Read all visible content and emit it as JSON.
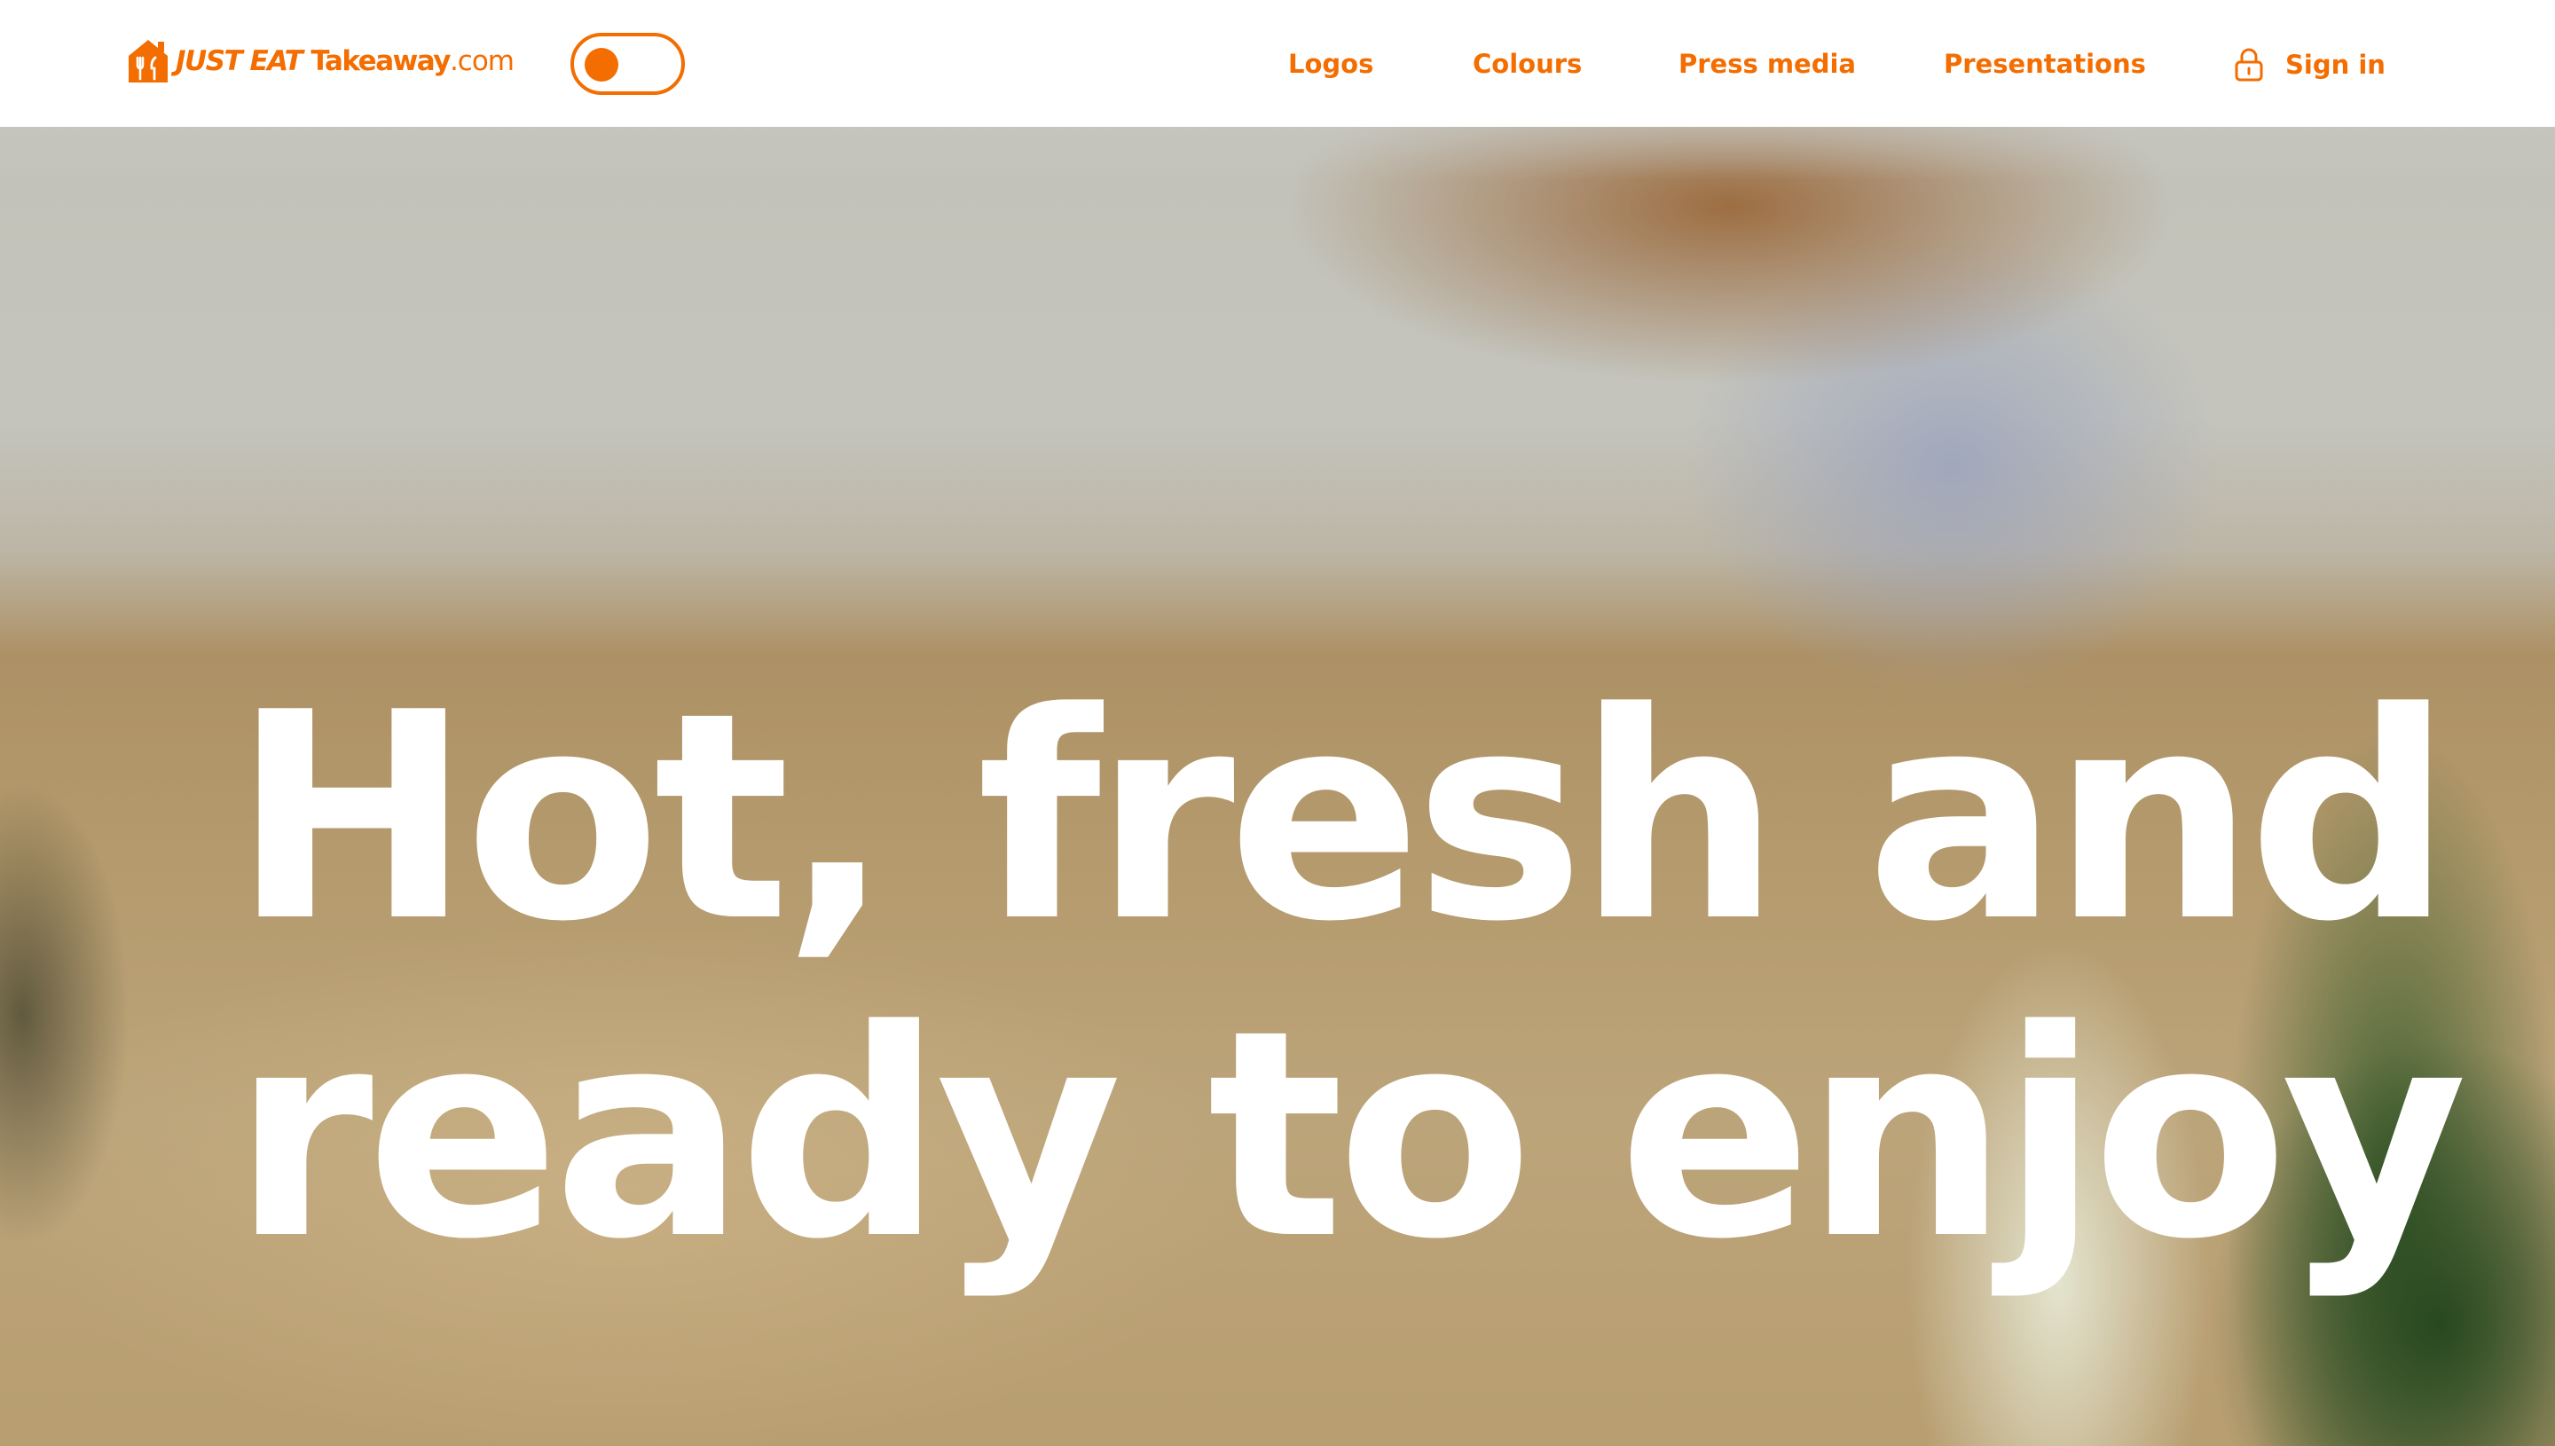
{
  "header": {
    "logo": {
      "part1": "JUST EAT",
      "part2": "Takeaway",
      "part3": ".com"
    },
    "theme_toggle": {
      "state": "off"
    },
    "nav": [
      {
        "label": "Logos"
      },
      {
        "label": "Colours"
      },
      {
        "label": "Press media"
      },
      {
        "label": "Presentations"
      }
    ],
    "sign_in": {
      "label": "Sign in",
      "icon": "lock-icon"
    }
  },
  "hero": {
    "title_line1": "Hot, fresh and",
    "title_line2": "ready to enjoy"
  },
  "colors": {
    "brand_orange": "#f36d00",
    "header_bg": "#ffffff",
    "hero_text": "#ffffff"
  }
}
